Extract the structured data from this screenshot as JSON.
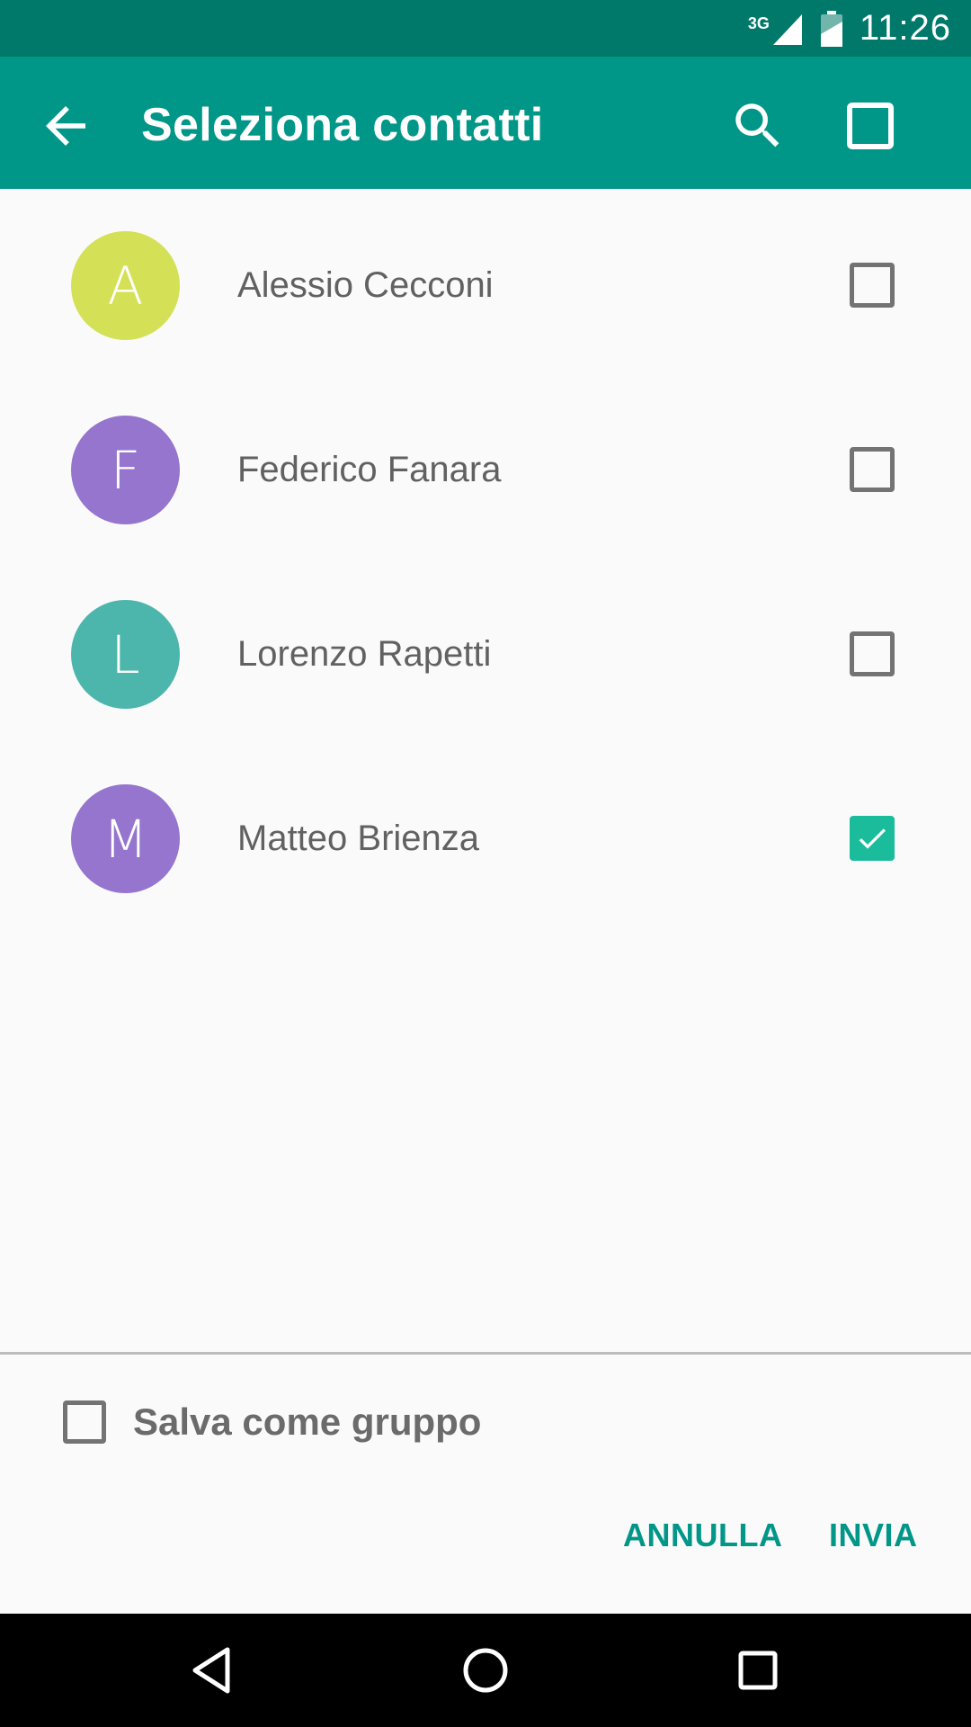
{
  "status_bar": {
    "network": "3G",
    "time": "11:26"
  },
  "app_bar": {
    "title": "Seleziona contatti",
    "icons": [
      "back-arrow-icon",
      "search-icon",
      "select-all-checkbox-icon"
    ]
  },
  "contacts": [
    {
      "initial": "A",
      "name": "Alessio Cecconi",
      "avatar_color": "#d4e157",
      "checked": false
    },
    {
      "initial": "F",
      "name": "Federico Fanara",
      "avatar_color": "#9575cd",
      "checked": false
    },
    {
      "initial": "L",
      "name": "Lorenzo Rapetti",
      "avatar_color": "#4db6ac",
      "checked": false
    },
    {
      "initial": "M",
      "name": "Matteo Brienza",
      "avatar_color": "#9575cd",
      "checked": true
    }
  ],
  "footer": {
    "save_group_label": "Salva come gruppo",
    "save_group_checked": false,
    "cancel_label": "ANNULLA",
    "send_label": "INVIA"
  },
  "colors": {
    "status_bar": "#00796b",
    "app_bar": "#009688",
    "accent": "#009688",
    "checked": "#1abc9c"
  },
  "nav_bar": {
    "icons": [
      "nav-back-icon",
      "nav-home-icon",
      "nav-recents-icon"
    ]
  }
}
